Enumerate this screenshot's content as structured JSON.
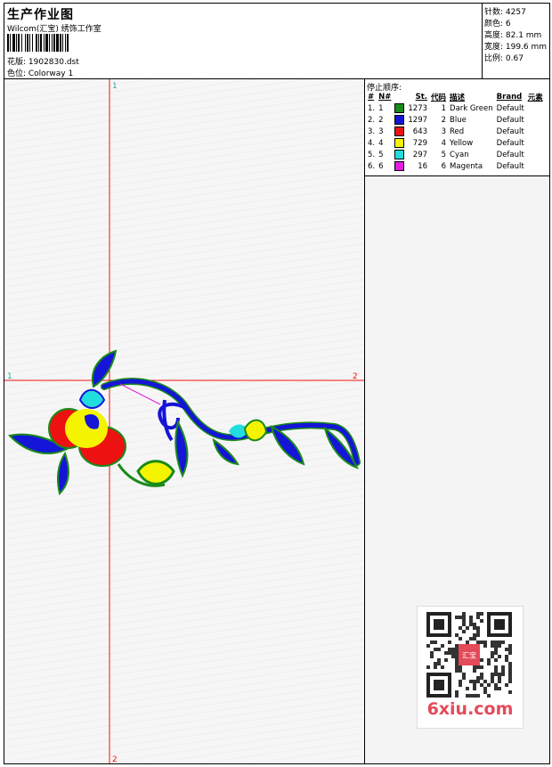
{
  "header": {
    "title": "生产作业图",
    "subtitle": "Wilcom(汇宝) 绣饰工作室",
    "design_line": "花版: 1902830.dst",
    "colorway_line": "色位: Colorway 1"
  },
  "stats": {
    "stitches": "针数: 4257",
    "colors": "颜色: 6",
    "height": "高度: 82.1 mm",
    "width": "宽度: 199.6 mm",
    "scale": "比例: 0.67"
  },
  "stop_panel": {
    "title": "停止顺序:",
    "headers": [
      "#",
      "N#",
      "St.",
      "代码",
      "描述",
      "Brand",
      "元素"
    ],
    "rows": [
      {
        "idx": "1.",
        "n": "1",
        "color": "#1a8a1a",
        "st": "1273",
        "code": "1",
        "desc": "Dark Green",
        "brand": "Default"
      },
      {
        "idx": "2.",
        "n": "2",
        "color": "#1515d8",
        "st": "1297",
        "code": "2",
        "desc": "Blue",
        "brand": "Default"
      },
      {
        "idx": "3.",
        "n": "3",
        "color": "#ee1111",
        "st": "643",
        "code": "3",
        "desc": "Red",
        "brand": "Default"
      },
      {
        "idx": "4.",
        "n": "4",
        "color": "#f4f400",
        "st": "729",
        "code": "4",
        "desc": "Yellow",
        "brand": "Default"
      },
      {
        "idx": "5.",
        "n": "5",
        "color": "#22dddd",
        "st": "297",
        "code": "5",
        "desc": "Cyan",
        "brand": "Default"
      },
      {
        "idx": "6.",
        "n": "6",
        "color": "#e11ee1",
        "st": "16",
        "code": "6",
        "desc": "Magenta",
        "brand": "Default"
      }
    ]
  },
  "axes": {
    "v_top": "1",
    "v_bottom": "2",
    "h_left": "1",
    "h_right": "2"
  },
  "watermark": {
    "brand": "6xiu.com",
    "seal": "汇宝"
  },
  "colors": {
    "crosshair": "#ee1111",
    "green": "#1a8a1a",
    "blue": "#1515d8",
    "red": "#ee1111",
    "yellow": "#f4f400",
    "cyan": "#22dddd",
    "magenta": "#e11ee1",
    "brand_red": "#e44a59"
  }
}
